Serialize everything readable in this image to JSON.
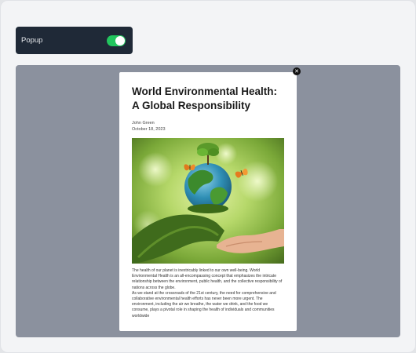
{
  "toggle": {
    "label": "Popup",
    "state": "on",
    "accent": "#22c55e"
  },
  "close_icon": "close-icon",
  "article": {
    "title": "World Environmental Health: A Global Responsibility",
    "author": "John Green",
    "date": "October 18, 2023",
    "image": "hand-holding-earth-with-butterflies",
    "paragraphs": [
      "The health of our planet is inextricably linked to our own well-being. World Environmental Health is an all-encompassing concept that emphasizes the intricate relationship between the environment, public health, and the collective responsibility of nations across the globe.",
      "As we stand at the crossroads of the 21st century, the need for comprehensive and collaborative environmental health efforts has never been more urgent. The environment, including the air we breathe, the water we drink, and the food we consume, plays a pivotal role in shaping the health of individuals and communities worldwide"
    ]
  }
}
